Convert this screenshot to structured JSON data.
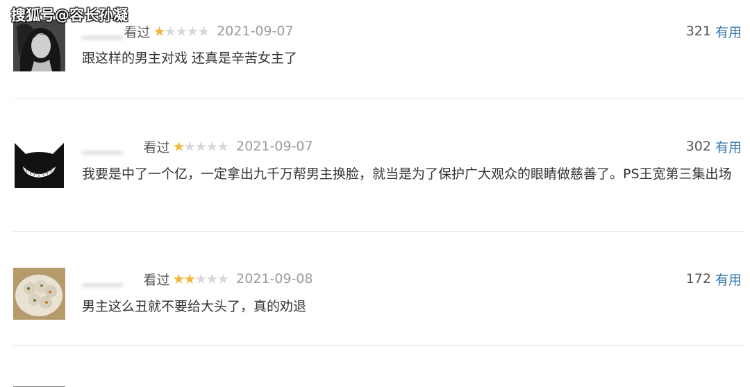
{
  "watermark": "搜狐号@容长孙凝",
  "reviews": [
    {
      "username": "▁▁▁▁",
      "watched": "看过",
      "rating": 1,
      "date": "2021-09-07",
      "votes": "321",
      "useful": "有用",
      "content": "跟这样的男主对戏 还真是辛苦女主了"
    },
    {
      "username": "▁▁▁▁",
      "watched": "看过",
      "rating": 1,
      "date": "2021-09-07",
      "votes": "302",
      "useful": "有用",
      "content": "我要是中了一个亿，一定拿出九千万帮男主换脸，就当是为了保护广大观众的眼睛做慈善了。PS王宽第三集出场"
    },
    {
      "username": "▁▁▁▁",
      "watched": "看过",
      "rating": 2,
      "date": "2021-09-08",
      "votes": "172",
      "useful": "有用",
      "content": "男主这么丑就不要给大头了，真的劝退"
    }
  ],
  "colors": {
    "star_on": "#f4b63b",
    "star_off": "#d8d8d8",
    "useful_link": "#3377aa",
    "divider": "#e6e6e6"
  }
}
